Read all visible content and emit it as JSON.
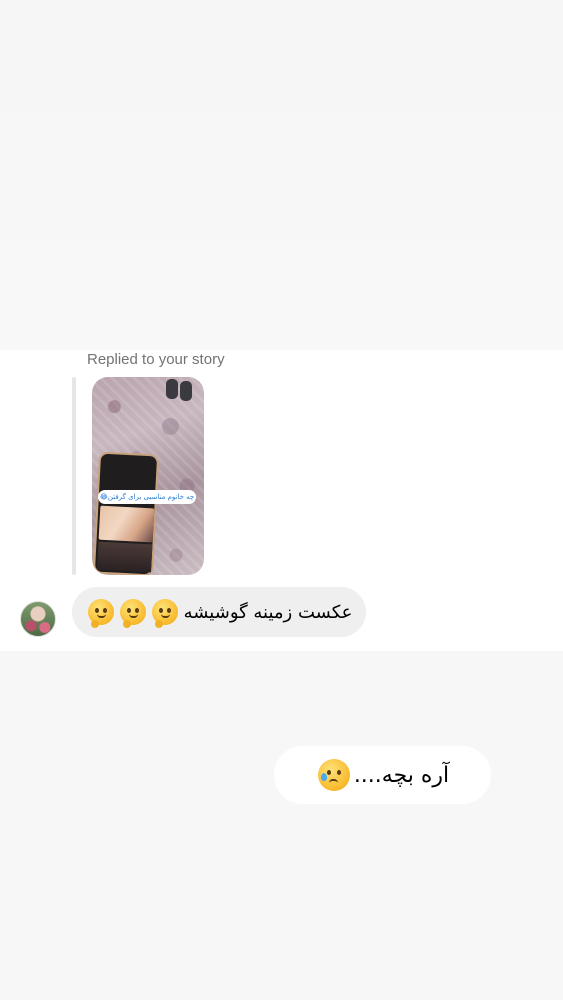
{
  "header": {
    "replied_label": "Replied to your story"
  },
  "story": {
    "caption": "چه خانوم مناسبی برای گرفتن😂"
  },
  "messages": {
    "received": {
      "text": "عکست زمینه گوشیشه",
      "emoji": [
        "melting-face-emoji",
        "melting-face-emoji",
        "melting-face-emoji"
      ]
    },
    "sent": {
      "text": "آره بچه....",
      "emoji": [
        "crying-face-emoji"
      ]
    }
  },
  "colors": {
    "received_bubble": "#efefef",
    "sent_bubble": "#ffffff",
    "page_bg": "#f7f7f7",
    "label_gray": "#737373"
  }
}
